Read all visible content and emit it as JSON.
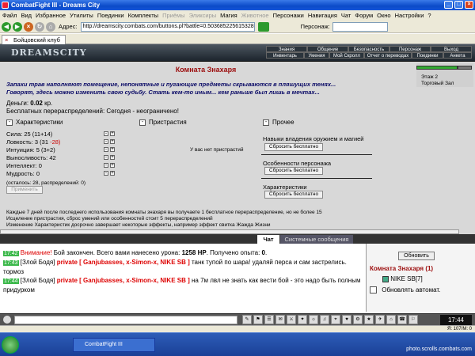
{
  "window": {
    "title": "CombatFight III - Dreams City"
  },
  "menu": [
    {
      "label": "Файл",
      "dim": false
    },
    {
      "label": "Вид",
      "dim": false
    },
    {
      "label": "Избранное",
      "dim": false
    },
    {
      "label": "Утилиты",
      "dim": false
    },
    {
      "label": "Поединки",
      "dim": false
    },
    {
      "label": "Комплекты",
      "dim": false
    },
    {
      "label": "Приёмы",
      "dim": true
    },
    {
      "label": "Эликсиры",
      "dim": true
    },
    {
      "label": "Магия",
      "dim": false
    },
    {
      "label": "Животное",
      "dim": true
    },
    {
      "label": "Персонажи",
      "dim": false
    },
    {
      "label": "Навигация",
      "dim": false
    },
    {
      "label": "Чат",
      "dim": false
    },
    {
      "label": "Форум",
      "dim": false
    },
    {
      "label": "Окно",
      "dim": false
    },
    {
      "label": "Настройки",
      "dim": false
    },
    {
      "label": "?",
      "dim": false
    }
  ],
  "address": {
    "label": "Адрес:",
    "url": "http://dreamscity.combats.com/buttons.pl?battle=0.503685225615328",
    "persona_label": "Персонаж:"
  },
  "tab": {
    "label": "Бойцовский клуб"
  },
  "banner": {
    "logo": "DREAMSCITY",
    "nav": [
      "Знания",
      "Общение",
      "Безопасность",
      "Персонаж",
      "Выход",
      "Инвентарь",
      "Умения",
      "Мой Скролл",
      "Отчет о переводах",
      "Поединки",
      "Анкета"
    ]
  },
  "room": {
    "title": "Комната Знахаря",
    "desc": "Запахи трав наполняют помещение, непонятные и пугающие предметы скрываются в пляшущих тенях... Говорят, здесь можно изменить свою судьбу. Стать кем-то иным... кем раньше был лишь в мечтах...",
    "money_label": "Деньги:",
    "money_value": "0.02",
    "money_unit": "кр.",
    "free_re": "Бесплатных перераспределений: Сегодня - неограничено!"
  },
  "side": {
    "floor": "Этаж 2",
    "place": "Торговый Зал"
  },
  "stats": {
    "head": "Характеристики",
    "rows": [
      {
        "name": "Сила:",
        "value": "25 (11+14)",
        "extra": ""
      },
      {
        "name": "Ловкость:",
        "value": "3 (31 ",
        "extra": "-28)"
      },
      {
        "name": "Интуиция:",
        "value": "5 (3+2)",
        "extra": ""
      },
      {
        "name": "Выносливость:",
        "value": "42",
        "extra": ""
      },
      {
        "name": "Интеллект:",
        "value": "0",
        "extra": ""
      },
      {
        "name": "Мудрость:",
        "value": "0",
        "extra": ""
      }
    ],
    "remaining": "(осталось: 28, распределений: 0)",
    "apply": "Применить"
  },
  "addictions": {
    "head": "Пристрастия",
    "empty": "У вас нет пристрастий"
  },
  "other": {
    "head": "Прочее",
    "weapons": "Навыки владения оружием и магией",
    "features": "Особенности персонажа",
    "chars": "Характеристики",
    "reset": "Сбросить бесплатно"
  },
  "notes": [
    "Каждые 7 дней после последнего использования комнаты знахаря вы получаете 1 бесплатное перераспределение, но не более 15",
    "Исцеление пристрастия, сброс умений или особенностей стоит 5 перераспределений",
    "Изменение Характеристик досрочно завершает некоторые эффекты, например эффект свитка Жажда Жизни"
  ],
  "chat": {
    "tabs": [
      "Чат",
      "Системные сообщения"
    ],
    "lines": [
      {
        "time": "17:42",
        "prefix": "Внимание!",
        "text": " Бой закончен. Всего вами нанесено урона: ",
        "bold1": "1258 HP",
        "text2": ". Получено опыта: ",
        "bold2": "0",
        "text3": "."
      },
      {
        "time": "17:43",
        "nick": "[Злой Бодя]",
        "pvt": "private [ Ganjubasses, x-Simon-x, NIKE SB ]",
        "msg": " танк тупой по шара! удаляй перса и сам застрелись. тормоз"
      },
      {
        "time": "17:44",
        "nick": "[Злой Бодя]",
        "pvt": "private [ Ganjubasses, x-Simon-x, NIKE SB ]",
        "msg": " на 7м лвл не знать как вести бой - это надо быть полным придурком"
      }
    ]
  },
  "rpanel": {
    "refresh": "Обновить",
    "title": "Комната Знахаря (1)",
    "user": "NIKE SB",
    "user_level": "[7]",
    "auto": "Обновлять автомат."
  },
  "clock": "17:44",
  "status": {
    "right": "Я: 107/M: 0"
  },
  "taskbar": {
    "app": "CombatFight III",
    "watermark": "photo.scrolls.combats.com"
  }
}
